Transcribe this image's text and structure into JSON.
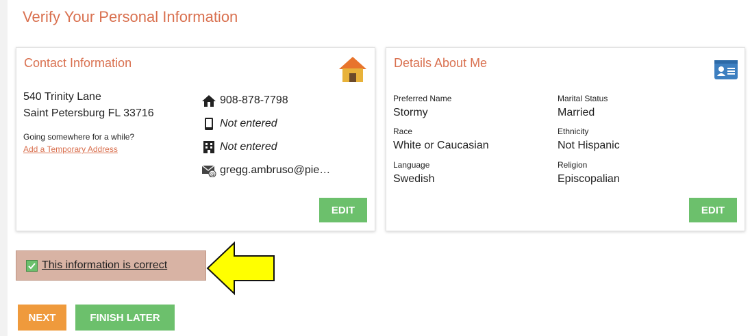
{
  "page": {
    "title": "Verify Your Personal Information"
  },
  "contact": {
    "title": "Contact Information",
    "icon": "house-icon",
    "address_line1": "540 Trinity Lane",
    "address_line2": "Saint Petersburg FL 33716",
    "temp_prompt": "Going somewhere for a while?",
    "temp_link": "Add a Temporary Address",
    "home_phone": "908-878-7798",
    "mobile_phone": "Not entered",
    "work_phone": "Not entered",
    "email": "gregg.ambruso@pie…",
    "edit_label": "EDIT"
  },
  "details": {
    "title": "Details About Me",
    "icon": "id-card-icon",
    "fields": [
      {
        "label": "Preferred Name",
        "value": "Stormy"
      },
      {
        "label": "Marital Status",
        "value": "Married"
      },
      {
        "label": "Race",
        "value": "White or Caucasian"
      },
      {
        "label": "Ethnicity",
        "value": "Not Hispanic"
      },
      {
        "label": "Language",
        "value": "Swedish"
      },
      {
        "label": "Religion",
        "value": "Episcopalian"
      }
    ],
    "edit_label": "EDIT"
  },
  "confirm": {
    "label": "This information is correct",
    "checked": true
  },
  "buttons": {
    "next": "NEXT",
    "finish_later": "FINISH LATER"
  },
  "colors": {
    "accent": "#d9704f",
    "green": "#6cc06c",
    "orange": "#ef9a3c",
    "confirm_bg": "#d8b3a4",
    "arrow": "#ffff00"
  }
}
